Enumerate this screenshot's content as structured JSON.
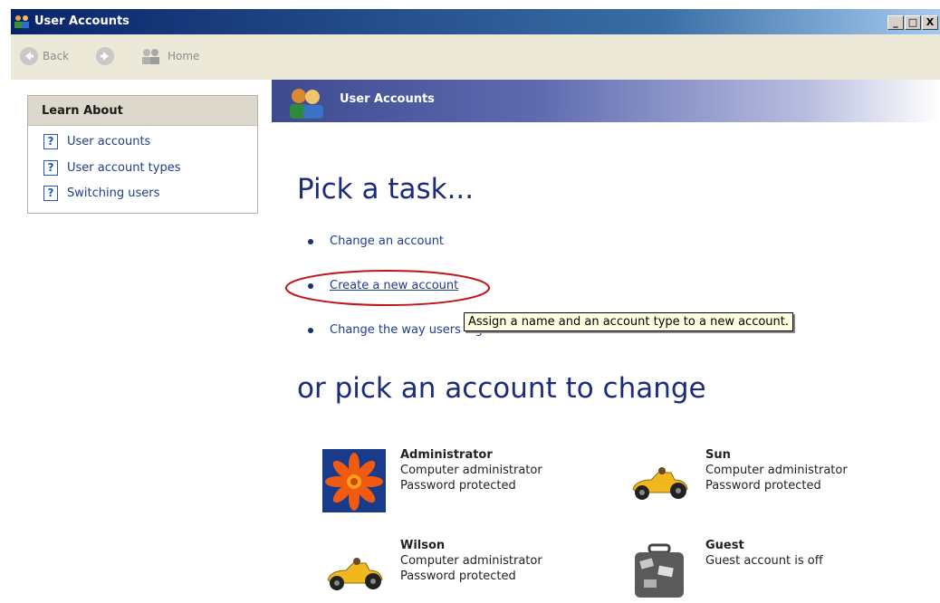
{
  "window": {
    "title": "User Accounts",
    "controls": [
      "_",
      "□",
      "X"
    ]
  },
  "toolbar": {
    "back_label": "Back",
    "home_label": "Home"
  },
  "sidebar": {
    "heading": "Learn About",
    "items": [
      {
        "label": "User accounts",
        "icon": "help-icon"
      },
      {
        "label": "User account types",
        "icon": "help-icon"
      },
      {
        "label": "Switching users",
        "icon": "help-icon"
      }
    ]
  },
  "header": {
    "title": "User Accounts"
  },
  "main": {
    "heading_tasks": "Pick a task...",
    "tasks": [
      {
        "label": "Change an account"
      },
      {
        "label": "Create a new account"
      },
      {
        "label": "Change the way users log on or off"
      }
    ],
    "tooltip": "Assign a name and an account type to a new account.",
    "heading_accounts": "or pick an account to change",
    "accounts": [
      {
        "name": "Administrator",
        "line1": "Computer administrator",
        "line2": "Password protected",
        "picture": "flower-icon"
      },
      {
        "name": "Sun",
        "line1": "Computer administrator",
        "line2": "Password protected",
        "picture": "race-car-icon"
      },
      {
        "name": "Wilson",
        "line1": "Computer administrator",
        "line2": "Password protected",
        "picture": "race-car-icon"
      },
      {
        "name": "Guest",
        "line1": "Guest account is off",
        "line2": "",
        "picture": "suitcase-icon"
      }
    ]
  },
  "colors": {
    "title_bar": "#0a246a",
    "link": "#1f3c8e",
    "heading": "#1c2b7a",
    "annotation_circle": "#c0141e"
  }
}
